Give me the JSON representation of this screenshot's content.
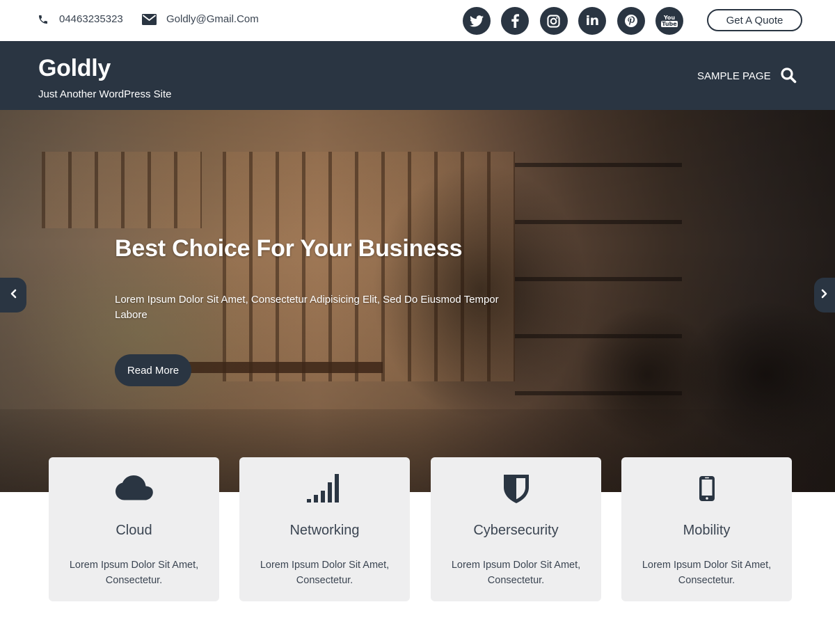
{
  "topbar": {
    "phone": {
      "icon": "phone-icon",
      "text": "04463235323"
    },
    "email": {
      "icon": "envelope-icon",
      "text": "Goldly@Gmail.Com"
    },
    "social": [
      {
        "name": "twitter",
        "icon": "twitter-icon"
      },
      {
        "name": "facebook",
        "icon": "facebook-icon"
      },
      {
        "name": "instagram",
        "icon": "instagram-icon"
      },
      {
        "name": "linkedin",
        "icon": "linkedin-icon",
        "text": "in"
      },
      {
        "name": "pinterest",
        "icon": "pinterest-icon"
      },
      {
        "name": "youtube",
        "icon": "youtube-icon",
        "text_top": "You",
        "text_bottom": "Tube"
      }
    ],
    "quote_label": "Get A Quote"
  },
  "header": {
    "site_title": "Goldly",
    "site_description": "Just Another WordPress Site",
    "nav": [
      {
        "label": "SAMPLE PAGE"
      }
    ],
    "search_icon": "search-icon"
  },
  "hero": {
    "title": "Best Choice For Your Business",
    "text": "Lorem Ipsum Dolor Sit Amet, Consectetur Adipisicing Elit, Sed Do Eiusmod Tempor Labore",
    "button_label": "Read More",
    "prev_icon": "chevron-left-icon",
    "next_icon": "chevron-right-icon"
  },
  "services": [
    {
      "icon": "cloud-icon",
      "title": "Cloud",
      "text": "Lorem Ipsum Dolor Sit Amet, Consectetur."
    },
    {
      "icon": "signal-bars-icon",
      "title": "Networking",
      "text": "Lorem Ipsum Dolor Sit Amet, Consectetur."
    },
    {
      "icon": "shield-icon",
      "title": "Cybersecurity",
      "text": "Lorem Ipsum Dolor Sit Amet, Consectetur."
    },
    {
      "icon": "mobile-icon",
      "title": "Mobility",
      "text": "Lorem Ipsum Dolor Sit Amet, Consectetur."
    }
  ],
  "colors": {
    "primary": "#2a3542",
    "card_background": "#eeeeef",
    "text": "#3b4552",
    "white": "#ffffff"
  }
}
